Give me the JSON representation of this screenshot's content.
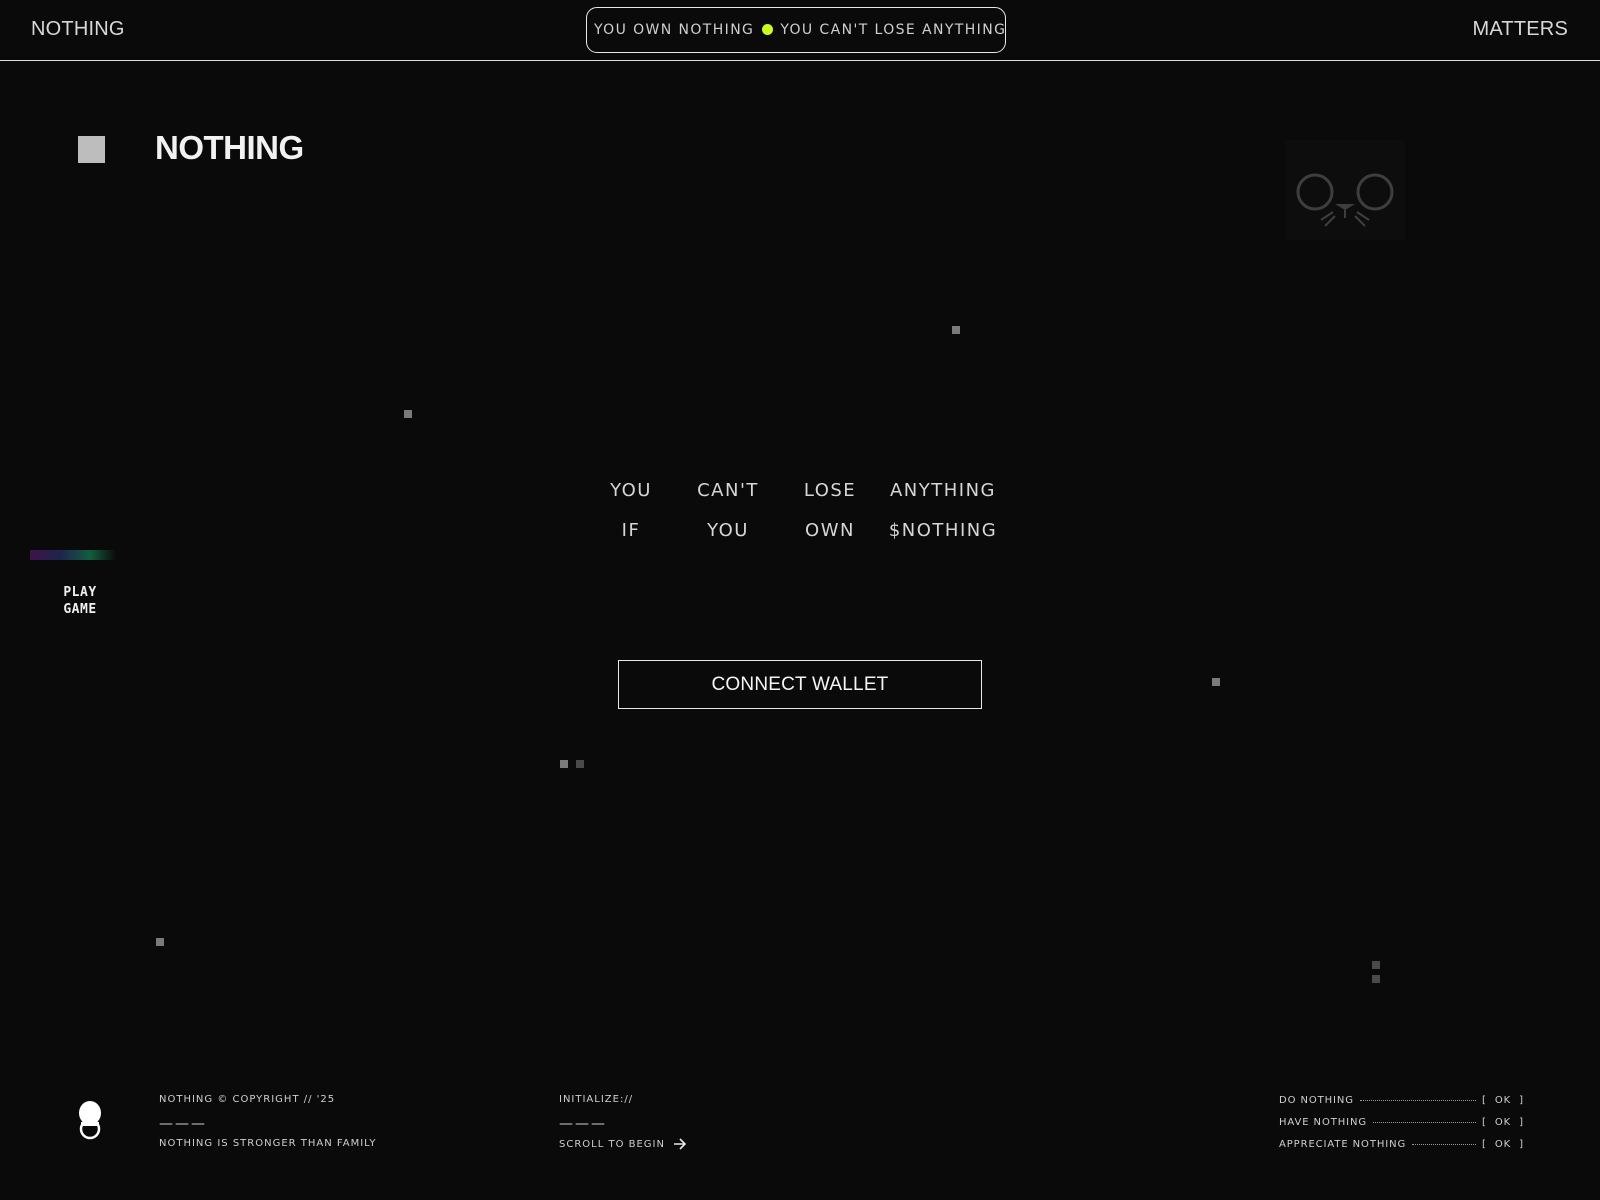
{
  "header": {
    "brand_left": "NOTHING",
    "brand_right": "MATTERS",
    "ticker": {
      "segment_1": "YOU OWN NOTHING",
      "segment_2": "YOU CAN'T LOSE ANYTHING IF Y",
      "dot_color": "#c8ff1e"
    }
  },
  "hero": {
    "title": "NOTHING",
    "words": [
      "YOU",
      "CAN'T",
      "LOSE",
      "ANYTHING",
      "IF",
      "YOU",
      "OWN",
      "$NOTHING"
    ],
    "connect_label": "CONNECT WALLET"
  },
  "sidebar": {
    "play_line1": "PLAY",
    "play_line2": "GAME"
  },
  "footer": {
    "copyright": "NOTHING © COPYRIGHT // '25",
    "dashes_1": "———",
    "tagline": "NOTHING IS STRONGER THAN FAMILY",
    "initialize": "INITIALIZE://",
    "dashes_2": "———",
    "scroll_label": "SCROLL TO BEGIN",
    "status": [
      {
        "label": "DO NOTHING",
        "value": "[ OK ]"
      },
      {
        "label": "HAVE NOTHING",
        "value": "[ OK ]"
      },
      {
        "label": "APPRECIATE NOTHING",
        "value": "[ OK ]"
      }
    ]
  },
  "icons": {
    "cat": "cat-face-icon",
    "logo": "mascot-logo-icon",
    "arrow": "arrow-right-icon"
  }
}
